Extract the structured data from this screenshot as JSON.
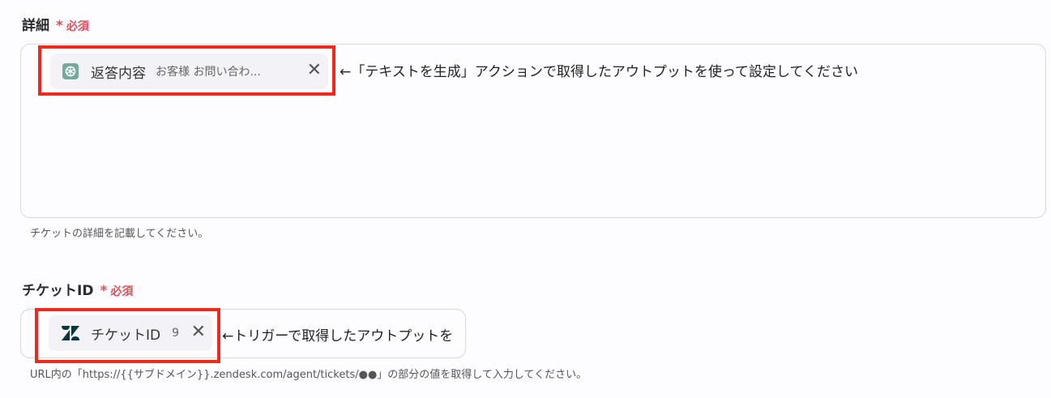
{
  "details_field": {
    "label": "詳細",
    "required_star": "*",
    "required_text": "必須",
    "chip": {
      "icon": "openai-icon",
      "label": "返答内容",
      "preview": "お客様 お問い合わ..."
    },
    "close_glyph": "✕",
    "annotation": "←「テキストを生成」アクションで取得したアウトプットを使って設定してください",
    "help_text": "チケットの詳細を記載してください。"
  },
  "ticket_id_field": {
    "label": "チケットID",
    "required_star": "*",
    "required_text": "必須",
    "chip": {
      "icon": "zendesk-icon",
      "label": "チケットID",
      "value": "9"
    },
    "close_glyph": "✕",
    "annotation": "←トリガーで取得したアウトプットを",
    "help_text": "URL内の「https://{{サブドメイン}}.zendesk.com/agent/tickets/●●」の部分の値を取得して入力してください。"
  },
  "colors": {
    "highlight": "#f0291e",
    "required": "#e0505a",
    "openai_icon": "#74aa9c",
    "zendesk_icon": "#03363d"
  }
}
